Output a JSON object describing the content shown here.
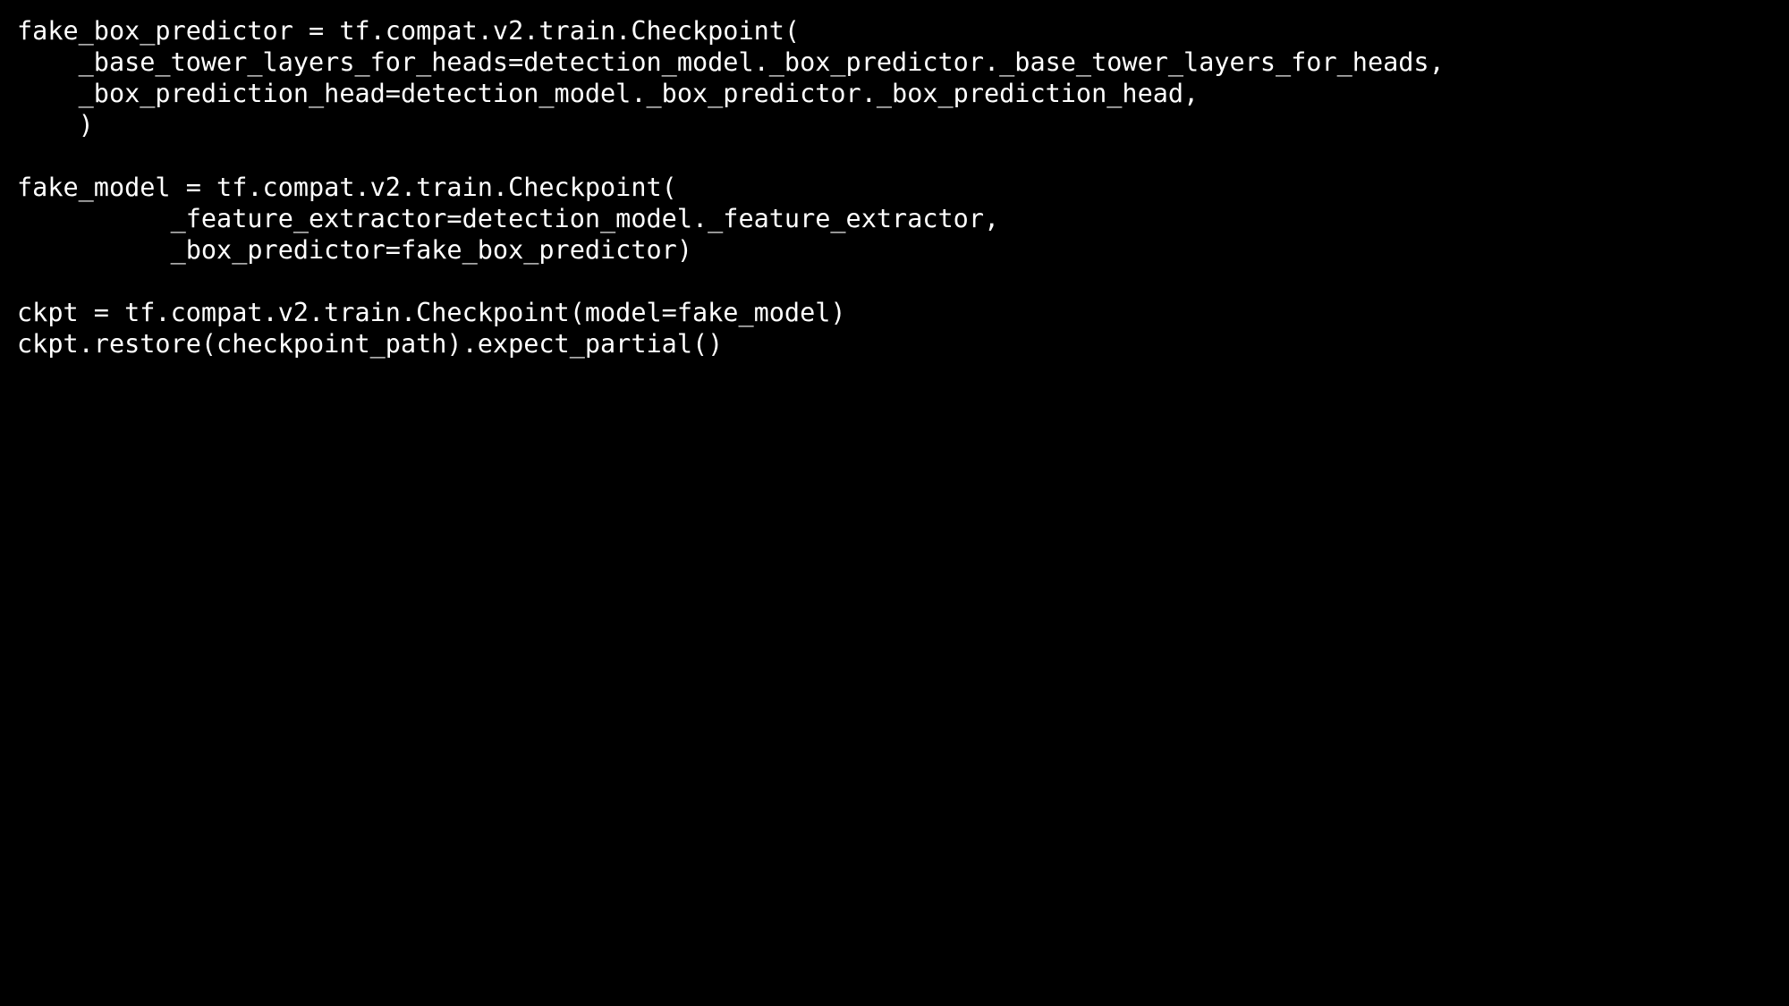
{
  "colors": {
    "background": "#000000",
    "text": "#ffffff"
  },
  "code": {
    "lines": [
      "fake_box_predictor = tf.compat.v2.train.Checkpoint(",
      "    _base_tower_layers_for_heads=detection_model._box_predictor._base_tower_layers_for_heads,",
      "    _box_prediction_head=detection_model._box_predictor._box_prediction_head,",
      "    )",
      "",
      "fake_model = tf.compat.v2.train.Checkpoint(",
      "          _feature_extractor=detection_model._feature_extractor,",
      "          _box_predictor=fake_box_predictor)",
      "",
      "ckpt = tf.compat.v2.train.Checkpoint(model=fake_model)",
      "ckpt.restore(checkpoint_path).expect_partial()"
    ]
  }
}
